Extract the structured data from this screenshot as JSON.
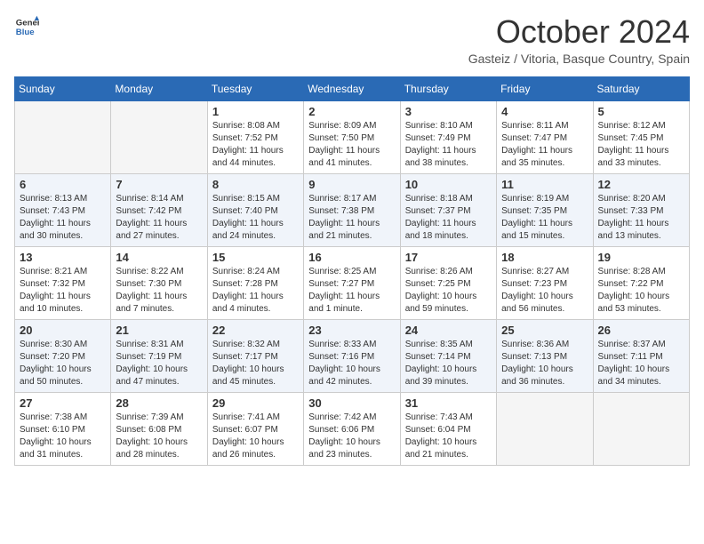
{
  "header": {
    "logo_general": "General",
    "logo_blue": "Blue",
    "month": "October 2024",
    "location": "Gasteiz / Vitoria, Basque Country, Spain"
  },
  "days_of_week": [
    "Sunday",
    "Monday",
    "Tuesday",
    "Wednesday",
    "Thursday",
    "Friday",
    "Saturday"
  ],
  "weeks": [
    [
      {
        "day": null
      },
      {
        "day": null
      },
      {
        "day": "1",
        "sunrise": "Sunrise: 8:08 AM",
        "sunset": "Sunset: 7:52 PM",
        "daylight": "Daylight: 11 hours and 44 minutes."
      },
      {
        "day": "2",
        "sunrise": "Sunrise: 8:09 AM",
        "sunset": "Sunset: 7:50 PM",
        "daylight": "Daylight: 11 hours and 41 minutes."
      },
      {
        "day": "3",
        "sunrise": "Sunrise: 8:10 AM",
        "sunset": "Sunset: 7:49 PM",
        "daylight": "Daylight: 11 hours and 38 minutes."
      },
      {
        "day": "4",
        "sunrise": "Sunrise: 8:11 AM",
        "sunset": "Sunset: 7:47 PM",
        "daylight": "Daylight: 11 hours and 35 minutes."
      },
      {
        "day": "5",
        "sunrise": "Sunrise: 8:12 AM",
        "sunset": "Sunset: 7:45 PM",
        "daylight": "Daylight: 11 hours and 33 minutes."
      }
    ],
    [
      {
        "day": "6",
        "sunrise": "Sunrise: 8:13 AM",
        "sunset": "Sunset: 7:43 PM",
        "daylight": "Daylight: 11 hours and 30 minutes."
      },
      {
        "day": "7",
        "sunrise": "Sunrise: 8:14 AM",
        "sunset": "Sunset: 7:42 PM",
        "daylight": "Daylight: 11 hours and 27 minutes."
      },
      {
        "day": "8",
        "sunrise": "Sunrise: 8:15 AM",
        "sunset": "Sunset: 7:40 PM",
        "daylight": "Daylight: 11 hours and 24 minutes."
      },
      {
        "day": "9",
        "sunrise": "Sunrise: 8:17 AM",
        "sunset": "Sunset: 7:38 PM",
        "daylight": "Daylight: 11 hours and 21 minutes."
      },
      {
        "day": "10",
        "sunrise": "Sunrise: 8:18 AM",
        "sunset": "Sunset: 7:37 PM",
        "daylight": "Daylight: 11 hours and 18 minutes."
      },
      {
        "day": "11",
        "sunrise": "Sunrise: 8:19 AM",
        "sunset": "Sunset: 7:35 PM",
        "daylight": "Daylight: 11 hours and 15 minutes."
      },
      {
        "day": "12",
        "sunrise": "Sunrise: 8:20 AM",
        "sunset": "Sunset: 7:33 PM",
        "daylight": "Daylight: 11 hours and 13 minutes."
      }
    ],
    [
      {
        "day": "13",
        "sunrise": "Sunrise: 8:21 AM",
        "sunset": "Sunset: 7:32 PM",
        "daylight": "Daylight: 11 hours and 10 minutes."
      },
      {
        "day": "14",
        "sunrise": "Sunrise: 8:22 AM",
        "sunset": "Sunset: 7:30 PM",
        "daylight": "Daylight: 11 hours and 7 minutes."
      },
      {
        "day": "15",
        "sunrise": "Sunrise: 8:24 AM",
        "sunset": "Sunset: 7:28 PM",
        "daylight": "Daylight: 11 hours and 4 minutes."
      },
      {
        "day": "16",
        "sunrise": "Sunrise: 8:25 AM",
        "sunset": "Sunset: 7:27 PM",
        "daylight": "Daylight: 11 hours and 1 minute."
      },
      {
        "day": "17",
        "sunrise": "Sunrise: 8:26 AM",
        "sunset": "Sunset: 7:25 PM",
        "daylight": "Daylight: 10 hours and 59 minutes."
      },
      {
        "day": "18",
        "sunrise": "Sunrise: 8:27 AM",
        "sunset": "Sunset: 7:23 PM",
        "daylight": "Daylight: 10 hours and 56 minutes."
      },
      {
        "day": "19",
        "sunrise": "Sunrise: 8:28 AM",
        "sunset": "Sunset: 7:22 PM",
        "daylight": "Daylight: 10 hours and 53 minutes."
      }
    ],
    [
      {
        "day": "20",
        "sunrise": "Sunrise: 8:30 AM",
        "sunset": "Sunset: 7:20 PM",
        "daylight": "Daylight: 10 hours and 50 minutes."
      },
      {
        "day": "21",
        "sunrise": "Sunrise: 8:31 AM",
        "sunset": "Sunset: 7:19 PM",
        "daylight": "Daylight: 10 hours and 47 minutes."
      },
      {
        "day": "22",
        "sunrise": "Sunrise: 8:32 AM",
        "sunset": "Sunset: 7:17 PM",
        "daylight": "Daylight: 10 hours and 45 minutes."
      },
      {
        "day": "23",
        "sunrise": "Sunrise: 8:33 AM",
        "sunset": "Sunset: 7:16 PM",
        "daylight": "Daylight: 10 hours and 42 minutes."
      },
      {
        "day": "24",
        "sunrise": "Sunrise: 8:35 AM",
        "sunset": "Sunset: 7:14 PM",
        "daylight": "Daylight: 10 hours and 39 minutes."
      },
      {
        "day": "25",
        "sunrise": "Sunrise: 8:36 AM",
        "sunset": "Sunset: 7:13 PM",
        "daylight": "Daylight: 10 hours and 36 minutes."
      },
      {
        "day": "26",
        "sunrise": "Sunrise: 8:37 AM",
        "sunset": "Sunset: 7:11 PM",
        "daylight": "Daylight: 10 hours and 34 minutes."
      }
    ],
    [
      {
        "day": "27",
        "sunrise": "Sunrise: 7:38 AM",
        "sunset": "Sunset: 6:10 PM",
        "daylight": "Daylight: 10 hours and 31 minutes."
      },
      {
        "day": "28",
        "sunrise": "Sunrise: 7:39 AM",
        "sunset": "Sunset: 6:08 PM",
        "daylight": "Daylight: 10 hours and 28 minutes."
      },
      {
        "day": "29",
        "sunrise": "Sunrise: 7:41 AM",
        "sunset": "Sunset: 6:07 PM",
        "daylight": "Daylight: 10 hours and 26 minutes."
      },
      {
        "day": "30",
        "sunrise": "Sunrise: 7:42 AM",
        "sunset": "Sunset: 6:06 PM",
        "daylight": "Daylight: 10 hours and 23 minutes."
      },
      {
        "day": "31",
        "sunrise": "Sunrise: 7:43 AM",
        "sunset": "Sunset: 6:04 PM",
        "daylight": "Daylight: 10 hours and 21 minutes."
      },
      {
        "day": null
      },
      {
        "day": null
      }
    ]
  ]
}
